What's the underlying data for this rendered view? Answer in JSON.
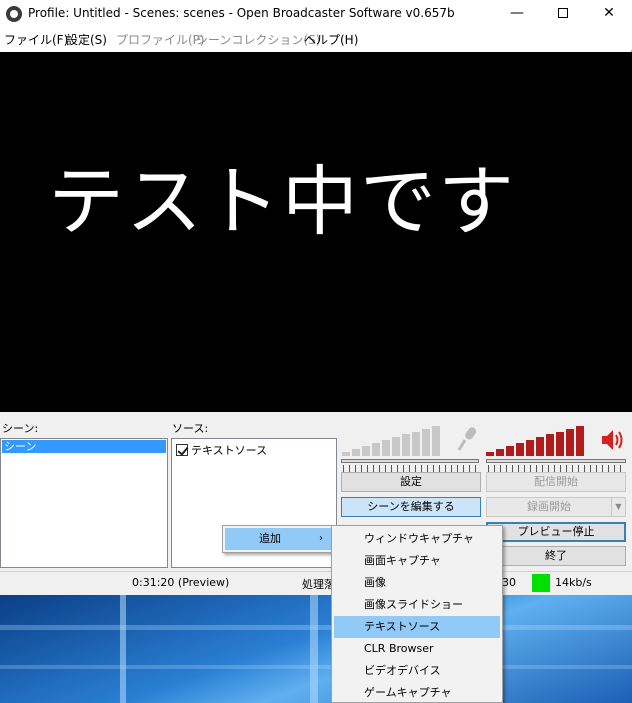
{
  "window": {
    "title": "Profile: Untitled - Scenes: scenes - Open Broadcaster Software v0.657b",
    "minimize_glyph": "—",
    "close_glyph": "✕"
  },
  "menubar": {
    "items": [
      {
        "label": "ファイル(F)",
        "enabled": true
      },
      {
        "label": "設定(S)",
        "enabled": true
      },
      {
        "label": "プロファイル(P)",
        "enabled": false
      },
      {
        "label": "シーンコレクション(S)",
        "enabled": false
      },
      {
        "label": "ヘルプ(H)",
        "enabled": true
      }
    ]
  },
  "preview": {
    "text": "テスト中です"
  },
  "scenes": {
    "label": "シーン:",
    "items": [
      "シーン"
    ]
  },
  "sources": {
    "label": "ソース:",
    "items": [
      {
        "label": "テキストソース",
        "checked": true
      }
    ]
  },
  "buttons": {
    "settings": "設定",
    "start_streaming": "配信開始",
    "edit_scene": "シーンを編集する",
    "start_recording": "録画開始",
    "stop_preview": "プレビュー停止",
    "exit": "終了"
  },
  "status": {
    "time": "0:31:20 (Preview)",
    "processing": "処理落",
    "fps": "30",
    "bitrate": "14kb/s",
    "indicator_color": "#00e000"
  },
  "context_menu": {
    "add_label": "追加",
    "submenu_arrow": "›"
  },
  "submenu": {
    "items": [
      {
        "label": "ウィンドウキャプチャ",
        "highlighted": false
      },
      {
        "label": "画面キャプチャ",
        "highlighted": false
      },
      {
        "label": "画像",
        "highlighted": false
      },
      {
        "label": "画像スライドショー",
        "highlighted": false
      },
      {
        "label": "テキストソース",
        "highlighted": true
      },
      {
        "label": "CLR Browser",
        "highlighted": false
      },
      {
        "label": "ビデオデバイス",
        "highlighted": false
      },
      {
        "label": "ゲームキャプチャ",
        "highlighted": false
      }
    ]
  },
  "icons": {
    "app": "obs-icon",
    "microphone": "microphone-icon",
    "speaker": "speaker-icon"
  },
  "colors": {
    "selection": "#3399ff",
    "menu_highlight": "#91c9f7",
    "mic_meter": "#c8c8c8",
    "desktop_meter": "#b01c1c",
    "speaker_icon": "#d42020"
  }
}
